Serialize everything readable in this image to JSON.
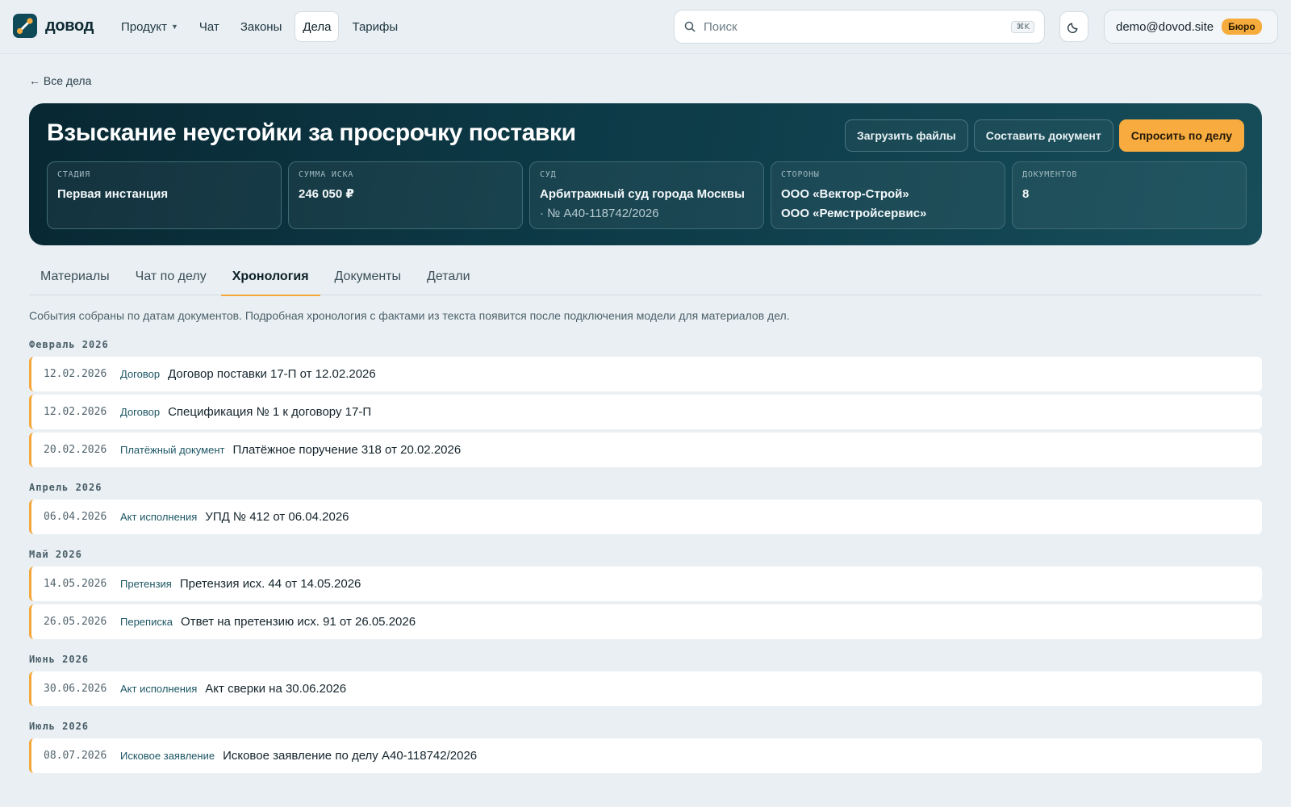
{
  "brand": {
    "name": "довод",
    "accent": "#f6ac3c",
    "dark": "#0d3a47"
  },
  "nav": {
    "items": [
      {
        "label": "Продукт",
        "dropdown": true
      },
      {
        "label": "Чат"
      },
      {
        "label": "Законы"
      },
      {
        "label": "Дела",
        "active": true
      },
      {
        "label": "Тарифы"
      }
    ]
  },
  "search": {
    "placeholder": "Поиск",
    "value": "",
    "shortcut": "⌘K"
  },
  "account": {
    "email": "demo@dovod.site",
    "plan": "Бюро"
  },
  "back_link": "← Все дела",
  "case": {
    "title": "Взыскание неустойки за просрочку поставки",
    "actions": {
      "upload": "Загрузить файлы",
      "compose": "Составить документ",
      "ask": "Спросить по делу"
    },
    "stats": {
      "stage": {
        "label": "Стадия",
        "value": "Первая инстанция"
      },
      "amount": {
        "label": "Сумма иска",
        "value": "246 050 ₽"
      },
      "court": {
        "label": "Суд",
        "value": "Арбитражный суд города Москвы",
        "sub": "· № А40-118742/2026"
      },
      "parties": {
        "label": "Стороны",
        "value": "ООО «Вектор-Строй»",
        "value2": "ООО «Ремстройсервис»"
      },
      "documents": {
        "label": "Документов",
        "value": "8"
      }
    }
  },
  "tabs": [
    {
      "label": "Материалы"
    },
    {
      "label": "Чат по делу"
    },
    {
      "label": "Хронология",
      "active": true
    },
    {
      "label": "Документы"
    },
    {
      "label": "Детали"
    }
  ],
  "timeline": {
    "note": "События собраны по датам документов. Подробная хронология с фактами из текста появится после подключения модели для материалов дел.",
    "groups": [
      {
        "month": "Февраль 2026",
        "events": [
          {
            "date": "12.02.2026",
            "type": "Договор",
            "title": "Договор поставки 17-П от 12.02.2026"
          },
          {
            "date": "12.02.2026",
            "type": "Договор",
            "title": "Спецификация № 1 к договору 17-П"
          },
          {
            "date": "20.02.2026",
            "type": "Платёжный документ",
            "title": "Платёжное поручение 318 от 20.02.2026"
          }
        ]
      },
      {
        "month": "Апрель 2026",
        "events": [
          {
            "date": "06.04.2026",
            "type": "Акт исполнения",
            "title": "УПД № 412 от 06.04.2026"
          }
        ]
      },
      {
        "month": "Май 2026",
        "events": [
          {
            "date": "14.05.2026",
            "type": "Претензия",
            "title": "Претензия исх. 44 от 14.05.2026"
          },
          {
            "date": "26.05.2026",
            "type": "Переписка",
            "title": "Ответ на претензию исх. 91 от 26.05.2026"
          }
        ]
      },
      {
        "month": "Июнь 2026",
        "events": [
          {
            "date": "30.06.2026",
            "type": "Акт исполнения",
            "title": "Акт сверки на 30.06.2026"
          }
        ]
      },
      {
        "month": "Июль 2026",
        "events": [
          {
            "date": "08.07.2026",
            "type": "Исковое заявление",
            "title": "Исковое заявление по делу А40-118742/2026"
          }
        ]
      }
    ]
  }
}
